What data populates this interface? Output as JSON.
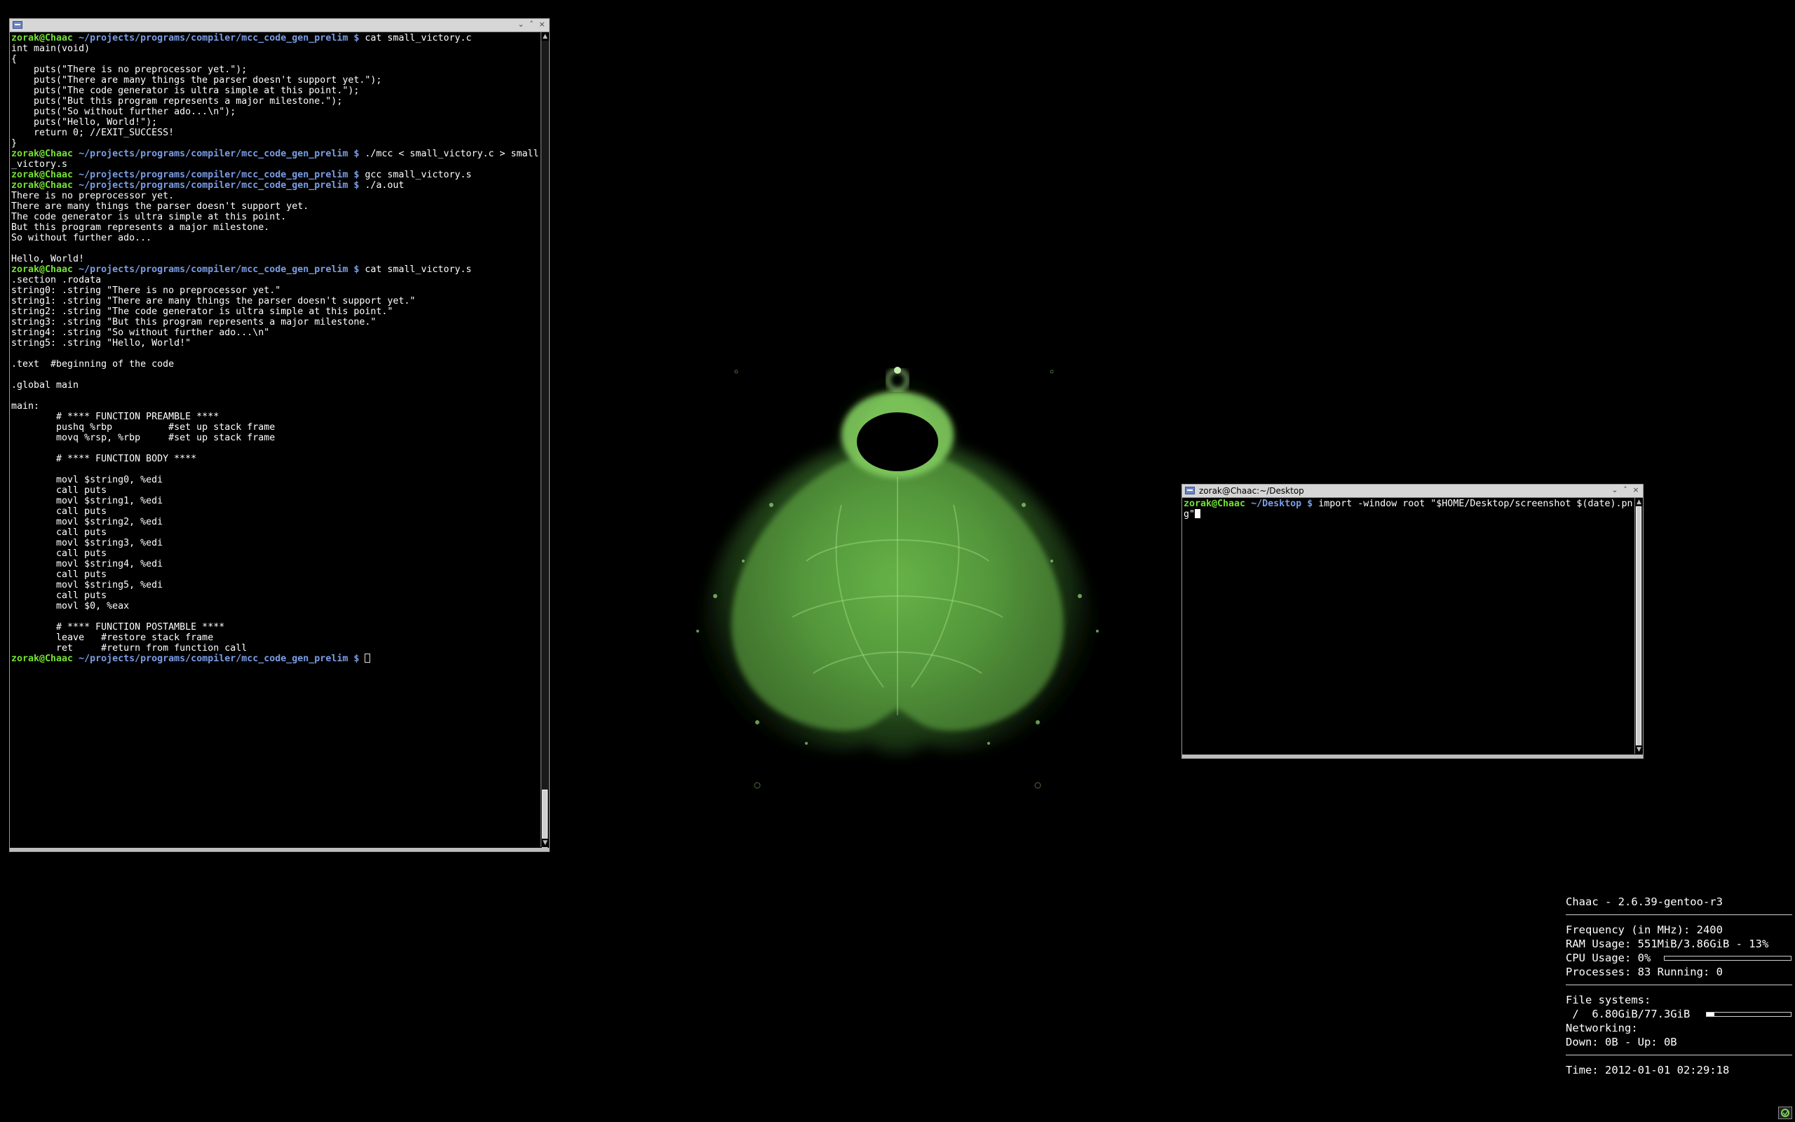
{
  "terminal_left": {
    "title": "",
    "controls": [
      "⌄",
      "˄",
      "×"
    ],
    "lines": [
      {
        "kind": "prompt",
        "user": "zorak@Chaac",
        "path": "~/projects/programs/compiler/mcc_code_gen_prelim",
        "dollar": "$",
        "cmd": "cat small_victory.c"
      },
      {
        "kind": "text",
        "text": "int main(void)"
      },
      {
        "kind": "text",
        "text": "{"
      },
      {
        "kind": "text",
        "text": "    puts(\"There is no preprocessor yet.\");"
      },
      {
        "kind": "text",
        "text": "    puts(\"There are many things the parser doesn't support yet.\");"
      },
      {
        "kind": "text",
        "text": "    puts(\"The code generator is ultra simple at this point.\");"
      },
      {
        "kind": "text",
        "text": "    puts(\"But this program represents a major milestone.\");"
      },
      {
        "kind": "text",
        "text": "    puts(\"So without further ado...\\n\");"
      },
      {
        "kind": "text",
        "text": "    puts(\"Hello, World!\");"
      },
      {
        "kind": "text",
        "text": "    return 0; //EXIT_SUCCESS!"
      },
      {
        "kind": "text",
        "text": "}"
      },
      {
        "kind": "prompt",
        "user": "zorak@Chaac",
        "path": "~/projects/programs/compiler/mcc_code_gen_prelim",
        "dollar": "$",
        "cmd": "./mcc < small_victory.c > small"
      },
      {
        "kind": "text",
        "text": "_victory.s"
      },
      {
        "kind": "prompt",
        "user": "zorak@Chaac",
        "path": "~/projects/programs/compiler/mcc_code_gen_prelim",
        "dollar": "$",
        "cmd": "gcc small_victory.s"
      },
      {
        "kind": "prompt",
        "user": "zorak@Chaac",
        "path": "~/projects/programs/compiler/mcc_code_gen_prelim",
        "dollar": "$",
        "cmd": "./a.out"
      },
      {
        "kind": "text",
        "text": "There is no preprocessor yet."
      },
      {
        "kind": "text",
        "text": "There are many things the parser doesn't support yet."
      },
      {
        "kind": "text",
        "text": "The code generator is ultra simple at this point."
      },
      {
        "kind": "text",
        "text": "But this program represents a major milestone."
      },
      {
        "kind": "text",
        "text": "So without further ado..."
      },
      {
        "kind": "text",
        "text": ""
      },
      {
        "kind": "text",
        "text": "Hello, World!"
      },
      {
        "kind": "prompt",
        "user": "zorak@Chaac",
        "path": "~/projects/programs/compiler/mcc_code_gen_prelim",
        "dollar": "$",
        "cmd": "cat small_victory.s"
      },
      {
        "kind": "text",
        "text": ".section .rodata"
      },
      {
        "kind": "text",
        "text": "string0: .string \"There is no preprocessor yet.\""
      },
      {
        "kind": "text",
        "text": "string1: .string \"There are many things the parser doesn't support yet.\""
      },
      {
        "kind": "text",
        "text": "string2: .string \"The code generator is ultra simple at this point.\""
      },
      {
        "kind": "text",
        "text": "string3: .string \"But this program represents a major milestone.\""
      },
      {
        "kind": "text",
        "text": "string4: .string \"So without further ado...\\n\""
      },
      {
        "kind": "text",
        "text": "string5: .string \"Hello, World!\""
      },
      {
        "kind": "text",
        "text": ""
      },
      {
        "kind": "text",
        "text": ".text  #beginning of the code"
      },
      {
        "kind": "text",
        "text": ""
      },
      {
        "kind": "text",
        "text": ".global main"
      },
      {
        "kind": "text",
        "text": ""
      },
      {
        "kind": "text",
        "text": "main:"
      },
      {
        "kind": "text",
        "text": "        # **** FUNCTION PREAMBLE ****"
      },
      {
        "kind": "text",
        "text": "        pushq %rbp          #set up stack frame"
      },
      {
        "kind": "text",
        "text": "        movq %rsp, %rbp     #set up stack frame"
      },
      {
        "kind": "text",
        "text": ""
      },
      {
        "kind": "text",
        "text": "        # **** FUNCTION BODY ****"
      },
      {
        "kind": "text",
        "text": ""
      },
      {
        "kind": "text",
        "text": "        movl $string0, %edi"
      },
      {
        "kind": "text",
        "text": "        call puts"
      },
      {
        "kind": "text",
        "text": "        movl $string1, %edi"
      },
      {
        "kind": "text",
        "text": "        call puts"
      },
      {
        "kind": "text",
        "text": "        movl $string2, %edi"
      },
      {
        "kind": "text",
        "text": "        call puts"
      },
      {
        "kind": "text",
        "text": "        movl $string3, %edi"
      },
      {
        "kind": "text",
        "text": "        call puts"
      },
      {
        "kind": "text",
        "text": "        movl $string4, %edi"
      },
      {
        "kind": "text",
        "text": "        call puts"
      },
      {
        "kind": "text",
        "text": "        movl $string5, %edi"
      },
      {
        "kind": "text",
        "text": "        call puts"
      },
      {
        "kind": "text",
        "text": "        movl $0, %eax"
      },
      {
        "kind": "text",
        "text": ""
      },
      {
        "kind": "text",
        "text": "        # **** FUNCTION POSTAMBLE ****"
      },
      {
        "kind": "text",
        "text": "        leave   #restore stack frame"
      },
      {
        "kind": "text",
        "text": "        ret     #return from function call"
      },
      {
        "kind": "prompt_cursor",
        "user": "zorak@Chaac",
        "path": "~/projects/programs/compiler/mcc_code_gen_prelim",
        "dollar": "$",
        "cmd": ""
      }
    ]
  },
  "terminal_right": {
    "title": "zorak@Chaac:~/Desktop",
    "controls": [
      "⌄",
      "˄",
      "×"
    ],
    "lines": [
      {
        "kind": "prompt",
        "user": "zorak@Chaac",
        "path": "~/Desktop",
        "dollar": "$",
        "cmd": "import -window root \"$HOME/Desktop/screenshot $(date).pn"
      },
      {
        "kind": "text_cursor",
        "text": "g\""
      }
    ]
  },
  "conky": {
    "header": "Chaac - 2.6.39-gentoo-r3",
    "frequency": "Frequency (in MHz): 2400",
    "ram": "RAM Usage: 551MiB/3.86GiB - 13%",
    "cpu_label": "CPU Usage: 0%",
    "cpu_fraction": 0.0,
    "processes": "Processes: 83  Running: 0",
    "fs_title": "File systems:",
    "fs_line": " /  6.80GiB/77.3GiB",
    "fs_fraction": 0.088,
    "net_title": "Networking:",
    "net_line": "Down: 0B  - Up: 0B",
    "time": "Time: 2012-01-01 02:29:18"
  },
  "colors": {
    "prompt_user": "#73e233",
    "prompt_path": "#7a9de6",
    "fractal": "#8fd46a",
    "titlebar": "#d6d6d6"
  },
  "icons": {
    "window_menu": "window-menu-icon",
    "tray": "tray-app-icon"
  }
}
